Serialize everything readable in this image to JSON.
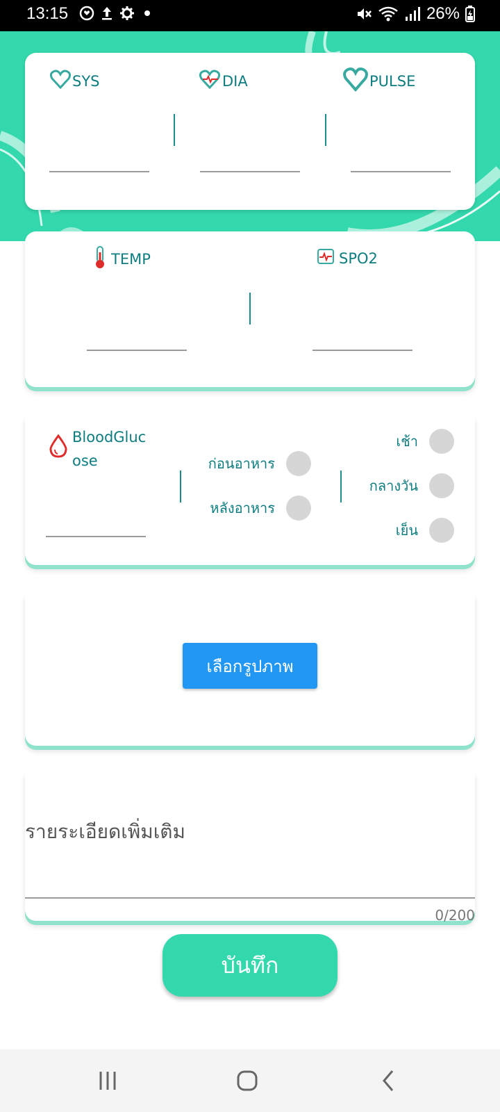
{
  "status_bar": {
    "time": "13:15",
    "battery": "26%",
    "left_icons": [
      "heart-shield-icon",
      "upload-icon",
      "gear-icon",
      "dot-icon"
    ],
    "right_icons": [
      "mute-icon",
      "wifi-icon",
      "signal-icon",
      "battery-icon"
    ]
  },
  "vitals": {
    "sys_label": "SYS",
    "dia_label": "DIA",
    "pulse_label": "PULSE"
  },
  "temp_card": {
    "temp_label": "TEMP",
    "spo2_label": "SPO2"
  },
  "glucose_card": {
    "label_line1": "BloodGluc",
    "label_line2": "ose",
    "before_meal": "ก่อนอาหาร",
    "after_meal": "หลังอาหาร",
    "morning": "เช้า",
    "midday": "กลางวัน",
    "evening": "เย็น"
  },
  "image_card": {
    "pick_image_button": "เลือกรูปภาพ"
  },
  "note_card": {
    "label": "รายระเอียดเพิ่มเติม",
    "counter": "0/200"
  },
  "save_button": "บันทึก",
  "colors": {
    "accent": "#34d8ad",
    "teal_text": "#0e7d80",
    "button_blue": "#2196f3",
    "radio_gray": "#d6d6d6"
  }
}
